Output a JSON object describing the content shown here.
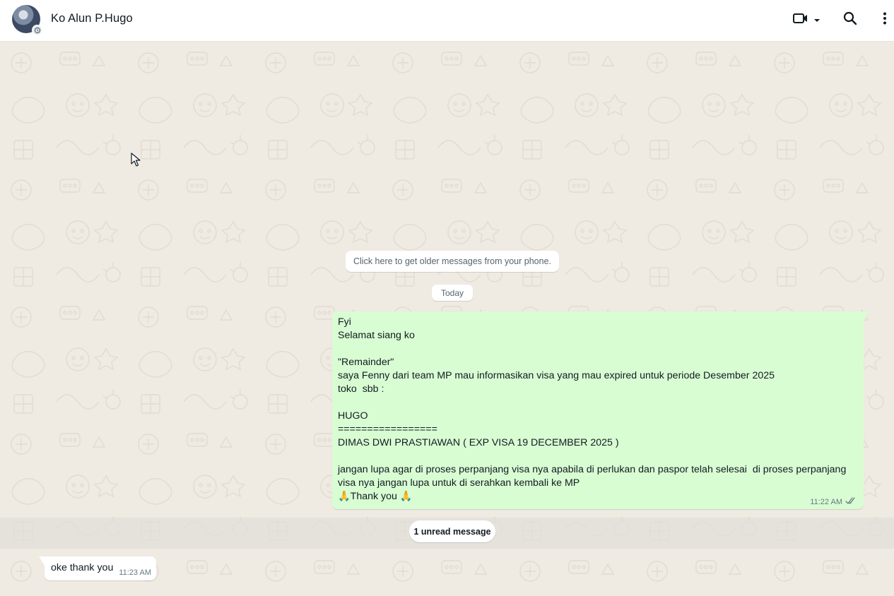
{
  "header": {
    "contact_name": "Ko Alun P.Hugo",
    "icons": {
      "video": "video-call-icon",
      "dropdown": "chevron-down-icon",
      "search": "search-icon",
      "menu": "more-vertical-icon"
    }
  },
  "chat": {
    "older_messages_prompt": "Click here to get older messages from your phone.",
    "date_divider": "Today",
    "outgoing_message": {
      "lines": [
        "Fyi",
        "Selamat siang ko",
        "",
        "\"Remainder\"",
        "saya Fenny dari team MP mau informasikan visa yang mau expired untuk periode Desember 2025",
        "toko  sbb :",
        "",
        "HUGO",
        "=================",
        "DIMAS DWI PRASTIAWAN ( EXP VISA 19 DECEMBER 2025 )",
        "",
        "jangan lupa agar di proses perpanjang visa nya apabila di perlukan dan paspor telah selesai  di proses perpanjang",
        "visa nya jangan lupa untuk di serahkan kembali ke MP",
        "🙏Thank you 🙏"
      ],
      "time": "11:22 AM",
      "status": "read"
    },
    "unread_label": "1 unread message",
    "incoming_message": {
      "text": "oke thank you",
      "time": "11:23 AM"
    }
  },
  "colors": {
    "outgoing_bubble": "#d9fdd3",
    "chat_background": "#efeae2",
    "read_ticks": "#667781"
  }
}
